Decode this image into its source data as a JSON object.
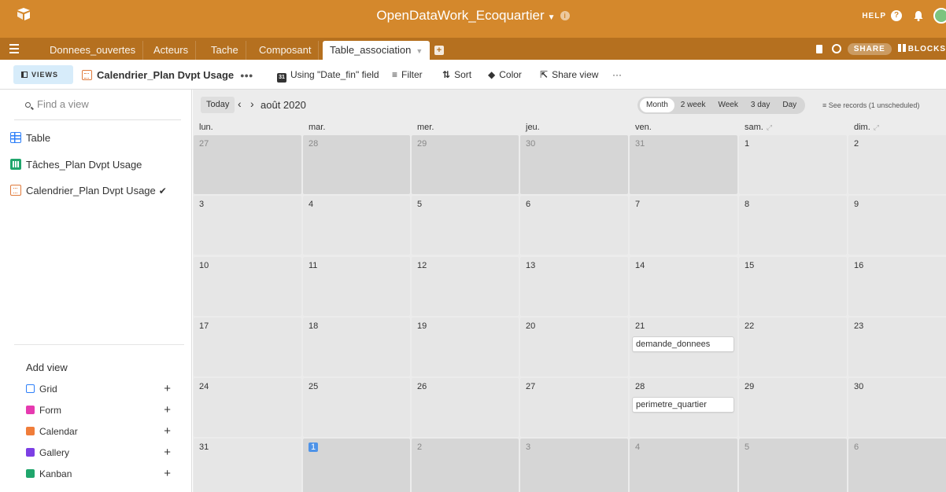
{
  "app": {
    "title": "OpenDataWork_Ecoquartier",
    "help": "HELP",
    "share": "SHARE",
    "blocks": "BLOCKS"
  },
  "tabs": [
    {
      "label": "Donnees_ouvertes"
    },
    {
      "label": "Acteurs"
    },
    {
      "label": "Tache"
    },
    {
      "label": "Composant"
    },
    {
      "label": "Table_association"
    }
  ],
  "toolbar": {
    "views": "VIEWS",
    "view_name": "Calendrier_Plan Dvpt Usage",
    "using_field": "Using \"Date_fin\" field",
    "filter": "Filter",
    "sort": "Sort",
    "color": "Color",
    "share_view": "Share view",
    "more": "···",
    "cal_icon_text": "31"
  },
  "sidebar": {
    "find_placeholder": "Find a view",
    "views": [
      {
        "label": "Table",
        "icon": "grid-icon"
      },
      {
        "label": "Tâches_Plan Dvpt Usage",
        "icon": "kanban-icon"
      },
      {
        "label": "Calendrier_Plan Dvpt Usage",
        "icon": "calendar-icon",
        "selected": true
      }
    ],
    "add_view_title": "Add view",
    "add_items": [
      {
        "label": "Grid",
        "color": "#2d7ff9"
      },
      {
        "label": "Form",
        "color": "#e63ab0"
      },
      {
        "label": "Calendar",
        "color": "#f07d3a"
      },
      {
        "label": "Gallery",
        "color": "#7c3fe4"
      },
      {
        "label": "Kanban",
        "color": "#20a66c"
      }
    ]
  },
  "calendar": {
    "today": "Today",
    "month": "août 2020",
    "ranges": [
      "Month",
      "2 week",
      "Week",
      "3 day",
      "Day"
    ],
    "selected_range": "Month",
    "records": "≡ See records (1 unscheduled)",
    "weekdays": [
      "lun.",
      "mar.",
      "mer.",
      "jeu.",
      "ven.",
      "sam.",
      "dim."
    ],
    "weeks": [
      [
        "27",
        "28",
        "29",
        "30",
        "31",
        "1",
        "2"
      ],
      [
        "3",
        "4",
        "5",
        "6",
        "7",
        "8",
        "9"
      ],
      [
        "10",
        "11",
        "12",
        "13",
        "14",
        "15",
        "16"
      ],
      [
        "17",
        "18",
        "19",
        "20",
        "21",
        "22",
        "23"
      ],
      [
        "24",
        "25",
        "26",
        "27",
        "28",
        "29",
        "30"
      ],
      [
        "31",
        "1",
        "2",
        "3",
        "4",
        "5",
        "6"
      ]
    ],
    "events": [
      {
        "date": "21",
        "label": "demande_donnees"
      },
      {
        "date": "28",
        "label": "perimetre_quartier"
      }
    ]
  }
}
